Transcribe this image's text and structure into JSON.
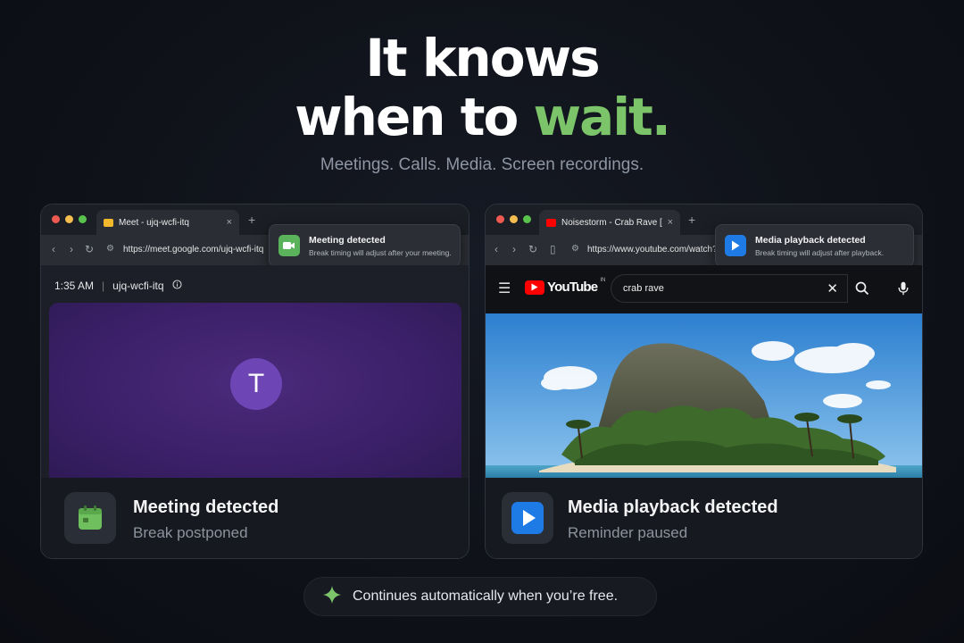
{
  "hero": {
    "line1": "It knows",
    "line2_prefix": "when to ",
    "line2_accent": "wait.",
    "subtitle": "Meetings. Calls. Media. Screen recordings."
  },
  "meet_card": {
    "tab_title": "Meet - ujq-wcfi-itq",
    "tab_close": "×",
    "new_tab": "+",
    "url": "https://meet.google.com/ujq-wcfi-itq",
    "toast_title": "Meeting detected",
    "toast_sub": "Break timing will adjust after your meeting.",
    "meeting_time": "1:35 AM",
    "meeting_divider": "|",
    "meeting_code": "ujq-wcfi-itq",
    "avatar_initial": "T",
    "status_title": "Meeting detected",
    "status_sub": "Break postponed"
  },
  "youtube_card": {
    "tab_title": "Noisestorm - Crab Rave [Mo",
    "tab_close": "×",
    "new_tab": "+",
    "url": "https://www.youtube.com/watch?v=",
    "toast_title": "Media playback detected",
    "toast_sub": "Break timing will adjust after playback.",
    "yt_logo_text": "YouTube",
    "yt_region": "IN",
    "search_query": "crab rave",
    "status_title": "Media playback detected",
    "status_sub": "Reminder paused"
  },
  "footer": {
    "text": "Continues automatically when you’re free."
  },
  "colors": {
    "accent_green": "#7cc46a",
    "meet_purple": "#3b2068",
    "play_blue": "#1e7be6",
    "youtube_red": "#ff0000"
  },
  "icons": [
    "video-camera-icon",
    "play-icon",
    "calendar-icon",
    "sparkle-icon",
    "search-icon",
    "mic-icon",
    "menu-icon",
    "info-icon"
  ]
}
